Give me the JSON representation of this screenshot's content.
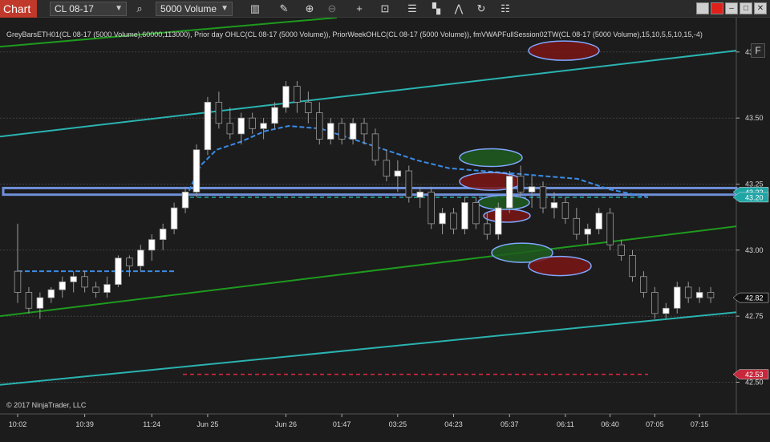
{
  "toolbar": {
    "chart_tab": "Chart",
    "instrument": "CL 08-17",
    "bar_type": "5000 Volume",
    "icons": [
      "search-icon",
      "bars-icon",
      "pencil-icon",
      "zoom-in-icon",
      "zoom-out-icon",
      "crosshair-icon",
      "data-box-icon",
      "strategy-icon",
      "templates-icon",
      "draw-icon",
      "refresh-icon",
      "properties-icon"
    ],
    "window_buttons": [
      "color-swatch",
      "red-swatch",
      "minimize",
      "maximize",
      "close"
    ]
  },
  "indicator_label": "GreyBarsETH01(CL 08-17 (5000 Volume),60000,113000), Prior day OHLC(CL 08-17 (5000 Volume)), PriorWeekOHLC(CL 08-17 (5000 Volume)), fmVWAPFullSession02TW(CL 08-17 (5000 Volume),15,10,5,5,10,15,-4)",
  "copyright": "© 2017 NinjaTrader, LLC",
  "f_button": "F",
  "price_axis": [
    "43.75",
    "43.50",
    "43.25",
    "43.00",
    "42.75",
    "42.50"
  ],
  "time_axis": [
    "10:02",
    "10:39",
    "11:24",
    "Jun 25",
    "Jun 26",
    "01:47",
    "03:25",
    "04:23",
    "05:37",
    "06:11",
    "06:40",
    "07:05",
    "07:15"
  ],
  "price_tags": {
    "vwap_top": "43.22",
    "vwap_mid": "43.20",
    "last": "42.82",
    "red_line": "42.53"
  },
  "colors": {
    "bull": "#ffffff",
    "bear": "#1c1c1c",
    "candle_outline": "#9a9a9a",
    "teal_channel": "#2ab3b0",
    "green_channel": "#1e9a1e",
    "vwap": "#3b8be6",
    "blue_band": "#6f8fd8",
    "red_line": "#e02840",
    "tag_teal": "#1fa5a5",
    "tag_red": "#c8283c"
  },
  "chart_data": {
    "type": "candlestick",
    "y_range": [
      42.38,
      43.88
    ],
    "grid": true,
    "candles": [
      [
        42.92,
        43.1,
        42.8,
        42.84
      ],
      [
        42.84,
        42.86,
        42.76,
        42.78
      ],
      [
        42.78,
        42.84,
        42.74,
        42.82
      ],
      [
        42.82,
        42.86,
        42.8,
        42.85
      ],
      [
        42.85,
        42.9,
        42.82,
        42.88
      ],
      [
        42.88,
        42.92,
        42.84,
        42.9
      ],
      [
        42.9,
        42.92,
        42.84,
        42.86
      ],
      [
        42.86,
        42.88,
        42.82,
        42.84
      ],
      [
        42.84,
        42.9,
        42.82,
        42.87
      ],
      [
        42.87,
        42.98,
        42.86,
        42.97
      ],
      [
        42.97,
        42.98,
        42.9,
        42.94
      ],
      [
        42.94,
        43.02,
        42.92,
        43.0
      ],
      [
        43.0,
        43.06,
        42.96,
        43.04
      ],
      [
        43.04,
        43.1,
        43.0,
        43.08
      ],
      [
        43.08,
        43.18,
        43.06,
        43.16
      ],
      [
        43.16,
        43.24,
        43.14,
        43.22
      ],
      [
        43.22,
        43.4,
        43.2,
        43.38
      ],
      [
        43.38,
        43.58,
        43.36,
        43.56
      ],
      [
        43.56,
        43.6,
        43.46,
        43.48
      ],
      [
        43.48,
        43.54,
        43.42,
        43.44
      ],
      [
        43.44,
        43.52,
        43.4,
        43.5
      ],
      [
        43.5,
        43.52,
        43.44,
        43.46
      ],
      [
        43.46,
        43.5,
        43.42,
        43.48
      ],
      [
        43.48,
        43.56,
        43.46,
        43.54
      ],
      [
        43.54,
        43.64,
        43.52,
        43.62
      ],
      [
        43.62,
        43.64,
        43.52,
        43.56
      ],
      [
        43.56,
        43.6,
        43.48,
        43.52
      ],
      [
        43.52,
        43.56,
        43.4,
        43.42
      ],
      [
        43.42,
        43.5,
        43.4,
        43.48
      ],
      [
        43.48,
        43.5,
        43.4,
        43.42
      ],
      [
        43.42,
        43.5,
        43.4,
        43.48
      ],
      [
        43.48,
        43.5,
        43.4,
        43.44
      ],
      [
        43.44,
        43.46,
        43.32,
        43.34
      ],
      [
        43.34,
        43.38,
        43.26,
        43.28
      ],
      [
        43.28,
        43.34,
        43.22,
        43.3
      ],
      [
        43.3,
        43.32,
        43.18,
        43.2
      ],
      [
        43.2,
        43.24,
        43.16,
        43.22
      ],
      [
        43.22,
        43.24,
        43.08,
        43.1
      ],
      [
        43.1,
        43.16,
        43.06,
        43.14
      ],
      [
        43.14,
        43.16,
        43.06,
        43.08
      ],
      [
        43.08,
        43.2,
        43.06,
        43.18
      ],
      [
        43.18,
        43.2,
        43.08,
        43.1
      ],
      [
        43.1,
        43.14,
        43.04,
        43.06
      ],
      [
        43.06,
        43.18,
        43.04,
        43.16
      ],
      [
        43.16,
        43.3,
        43.14,
        43.28
      ],
      [
        43.28,
        43.32,
        43.2,
        43.22
      ],
      [
        43.22,
        43.28,
        43.16,
        43.24
      ],
      [
        43.24,
        43.26,
        43.14,
        43.16
      ],
      [
        43.16,
        43.22,
        43.12,
        43.18
      ],
      [
        43.18,
        43.2,
        43.1,
        43.12
      ],
      [
        43.12,
        43.16,
        43.04,
        43.06
      ],
      [
        43.06,
        43.1,
        43.02,
        43.08
      ],
      [
        43.08,
        43.16,
        43.06,
        43.14
      ],
      [
        43.14,
        43.16,
        43.0,
        43.02
      ],
      [
        43.02,
        43.04,
        42.96,
        42.98
      ],
      [
        42.98,
        43.0,
        42.88,
        42.9
      ],
      [
        42.9,
        42.92,
        42.82,
        42.84
      ],
      [
        42.84,
        42.86,
        42.74,
        42.76
      ],
      [
        42.76,
        42.8,
        42.74,
        42.78
      ],
      [
        42.78,
        42.88,
        42.76,
        42.86
      ],
      [
        42.86,
        42.88,
        42.8,
        42.82
      ],
      [
        42.82,
        42.86,
        42.8,
        42.84
      ],
      [
        42.84,
        42.86,
        42.8,
        42.82
      ]
    ]
  }
}
